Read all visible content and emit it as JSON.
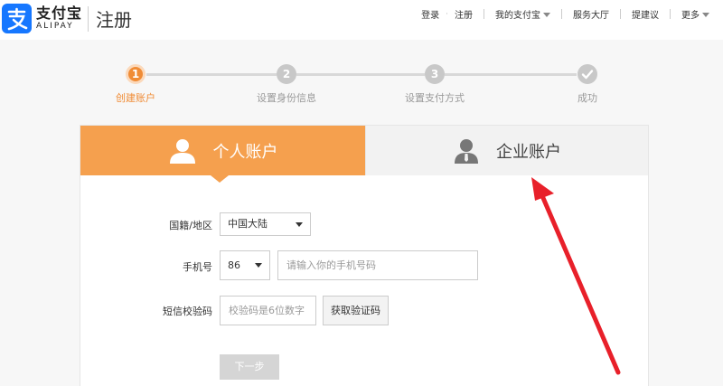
{
  "header": {
    "logo_cn": "支付宝",
    "logo_en": "ALIPAY",
    "subtitle": "注册",
    "nav": {
      "login": "登录",
      "register": "注册",
      "my_alipay": "我的支付宝",
      "service_hall": "服务大厅",
      "suggest": "提建议",
      "more": "更多"
    }
  },
  "steps": [
    {
      "num": "1",
      "label": "创建账户",
      "active": true
    },
    {
      "num": "2",
      "label": "设置身份信息",
      "active": false
    },
    {
      "num": "3",
      "label": "设置支付方式",
      "active": false
    },
    {
      "num": "",
      "label": "成功",
      "active": false
    }
  ],
  "tabs": {
    "personal": "个人账户",
    "business": "企业账户"
  },
  "form": {
    "nationality_label": "国籍/地区",
    "nationality_value": "中国大陆",
    "phone_label": "手机号",
    "country_code": "86",
    "phone_placeholder": "请输入你的手机号码",
    "sms_label": "短信校验码",
    "sms_placeholder": "校验码是6位数字",
    "get_code_button": "获取验证码",
    "next_button": "下一步"
  },
  "colors": {
    "brand_blue": "#1677ff",
    "accent_orange": "#f5a04e",
    "annotation_red": "#e8202a"
  }
}
